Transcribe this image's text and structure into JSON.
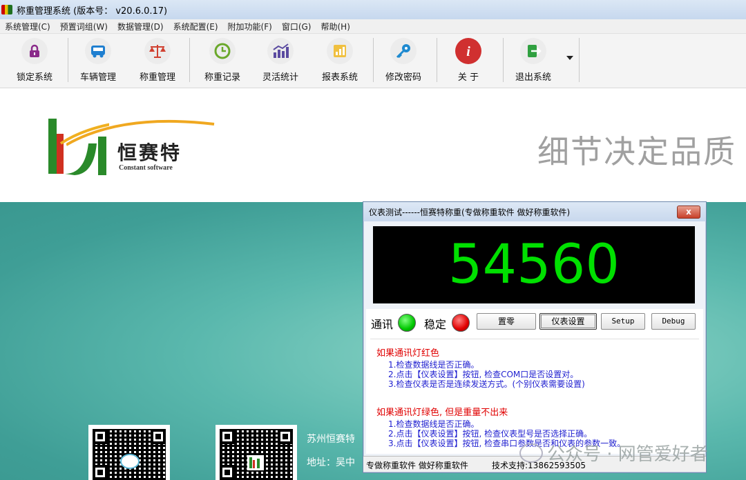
{
  "window": {
    "title": "称重管理系统 (版本号： v20.6.0.17)"
  },
  "menu": [
    "系统管理(C)",
    "预置词组(W)",
    "数据管理(D)",
    "系统配置(E)",
    "附加功能(F)",
    "窗口(G)",
    "帮助(H)"
  ],
  "toolbar": [
    {
      "label": "锁定系统",
      "icon": "lock-icon",
      "color": "#8a2a8a"
    },
    {
      "label": "车辆管理",
      "icon": "truck-icon",
      "color": "#1f7fd0"
    },
    {
      "label": "称重管理",
      "icon": "scale-icon",
      "color": "#d04030"
    },
    {
      "label": "称重记录",
      "icon": "clock-icon",
      "color": "#6aa82a"
    },
    {
      "label": "灵活统计",
      "icon": "chart-icon",
      "color": "#5a4aa0"
    },
    {
      "label": "报表系统",
      "icon": "report-icon",
      "color": "#e0a020"
    },
    {
      "label": "修改密码",
      "icon": "key-icon",
      "color": "#1e8ad0"
    },
    {
      "label": "关 于",
      "icon": "info-icon",
      "color": "#d03030"
    },
    {
      "label": "退出系统",
      "icon": "exit-icon",
      "color": "#30a040"
    }
  ],
  "banner": {
    "logo_cn": "恒赛特",
    "logo_en": "Constant software",
    "slogan": "细节决定品质"
  },
  "footer": {
    "company": "苏州恒赛特",
    "address": "地址：吴中"
  },
  "watermark": "公众号 · 网管爱好者",
  "dialog": {
    "title": "仪表测试------恒赛特称重(专做称重软件 做好称重软件)",
    "close": "x",
    "reading": "54560",
    "comm_label": "通讯",
    "stable_label": "稳定",
    "buttons": {
      "zero": "置零",
      "meter_settings": "仪表设置",
      "setup": "Setup",
      "debug": "Debug"
    },
    "help1": {
      "title": "如果通讯灯红色",
      "lines": [
        "1.检查数据线是否正确。",
        "2.点击【仪表设置】按钮, 检查COM口是否设置对。",
        "3.检查仪表是否是连续发送方式。(个别仪表需要设置)"
      ]
    },
    "help2": {
      "title": "如果通讯灯绿色, 但是重量不出来",
      "lines": [
        "1.检查数据线是否正确。",
        "2.点击【仪表设置】按钮, 检查仪表型号是否选择正确。",
        "3.点击【仪表设置】按钮, 检查串口参数是否和仪表的参数一致。"
      ]
    },
    "status_left": "专做称重软件 做好称重软件",
    "status_right": "技术支持:13862593505"
  }
}
